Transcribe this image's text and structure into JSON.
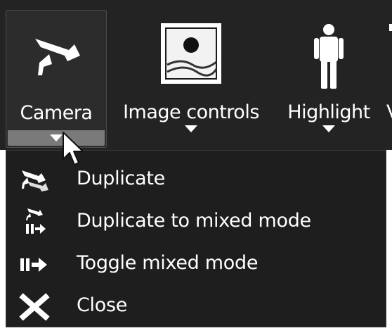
{
  "toolbar": {
    "buttons": [
      {
        "label": "Camera",
        "icon": "camera-icon",
        "state": "pressed",
        "has_dropdown": true
      },
      {
        "label": "Image controls",
        "icon": "image-controls-icon",
        "has_dropdown": true
      },
      {
        "label": "Highlight",
        "icon": "highlight-person-icon",
        "has_dropdown": true
      },
      {
        "label": "V",
        "icon": "partial-icon",
        "truncated": true
      }
    ]
  },
  "menu": {
    "items": [
      {
        "label": "Duplicate",
        "icon": "duplicate-camera-icon"
      },
      {
        "label": "Duplicate to mixed mode",
        "icon": "duplicate-mixed-mode-icon"
      },
      {
        "label": "Toggle mixed mode",
        "icon": "toggle-mixed-mode-icon"
      },
      {
        "label": "Close",
        "icon": "close-icon"
      }
    ]
  },
  "colors": {
    "toolbar_bg": "#232323",
    "menu_bg": "#1e1e1e",
    "text": "#ffffff",
    "dropdown_bar": "#7a7a7a"
  }
}
